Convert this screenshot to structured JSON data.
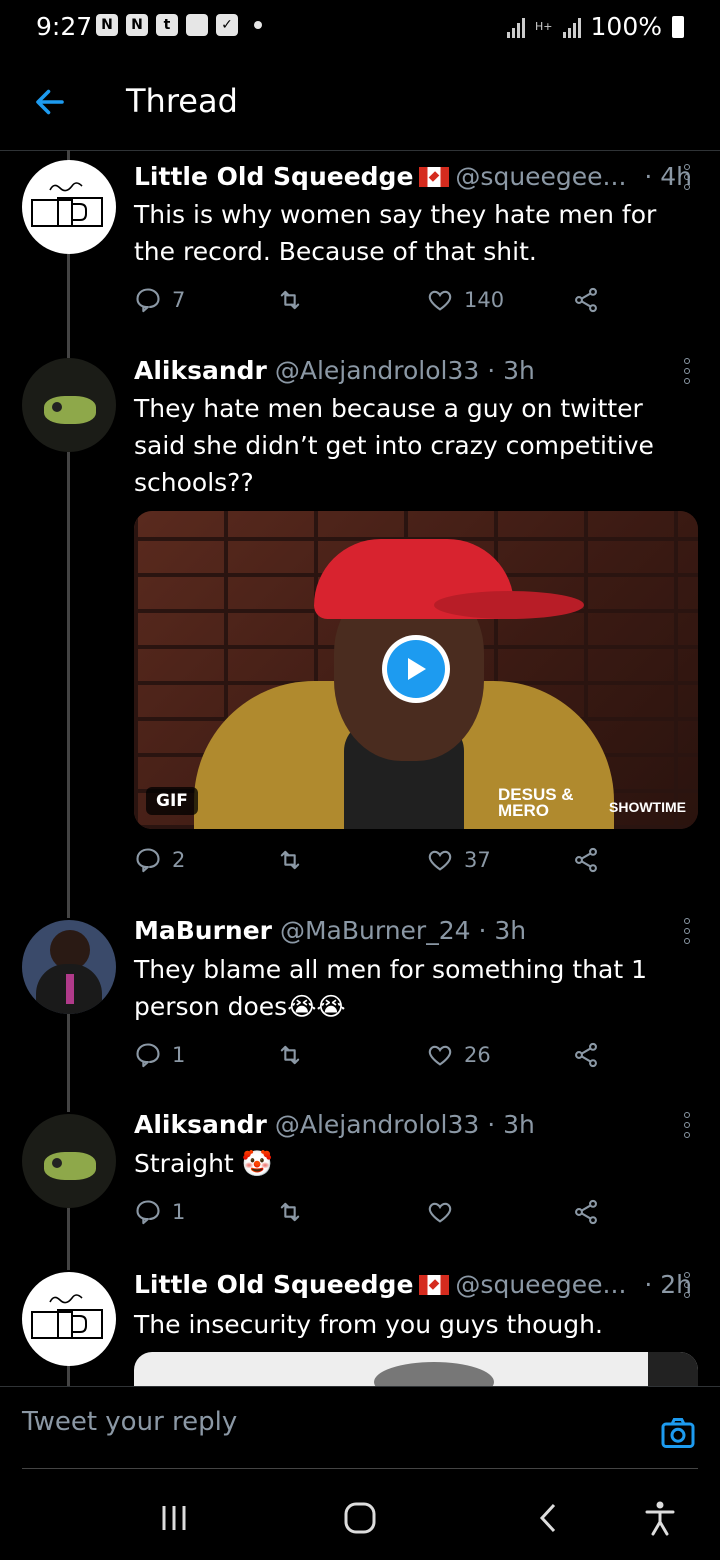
{
  "status_bar": {
    "time": "9:27",
    "battery": "100%",
    "network": "H+"
  },
  "header": {
    "title": "Thread"
  },
  "tweets": [
    {
      "name": "Little Old Squeedge",
      "handle": "@squeegee...",
      "time": "· 4h",
      "text": "This is why women say they hate men for the record. Because of that shit.",
      "replies": "7",
      "retweets": "",
      "likes": "140"
    },
    {
      "name": "Aliksandr",
      "handle": "@Alejandrolol33 · 3h",
      "time": "",
      "text": "They hate men because a guy on twitter said she didn’t get into crazy competitive schools??",
      "media": {
        "type": "GIF",
        "badge": "GIF",
        "brand": "DESUS & MERO",
        "network_logo": "SHOWTIME"
      },
      "replies": "2",
      "retweets": "",
      "likes": "37"
    },
    {
      "name": "MaBurner",
      "handle": "@MaBurner_24 · 3h",
      "time": "",
      "text": "They blame all men for something that 1 person does😭😭",
      "replies": "1",
      "retweets": "",
      "likes": "26"
    },
    {
      "name": "Aliksandr",
      "handle": "@Alejandrolol33 · 3h",
      "time": "",
      "text": "Straight 🤡",
      "replies": "1",
      "retweets": "",
      "likes": ""
    },
    {
      "name": "Little Old Squeedge",
      "handle": "@squeegee...",
      "time": "· 2h",
      "text": "The insecurity from you guys though."
    }
  ],
  "reply_bar": {
    "placeholder": "Tweet your reply"
  },
  "colors": {
    "accent": "#1d9bf0",
    "muted": "#8b98a5",
    "background": "#000000"
  }
}
